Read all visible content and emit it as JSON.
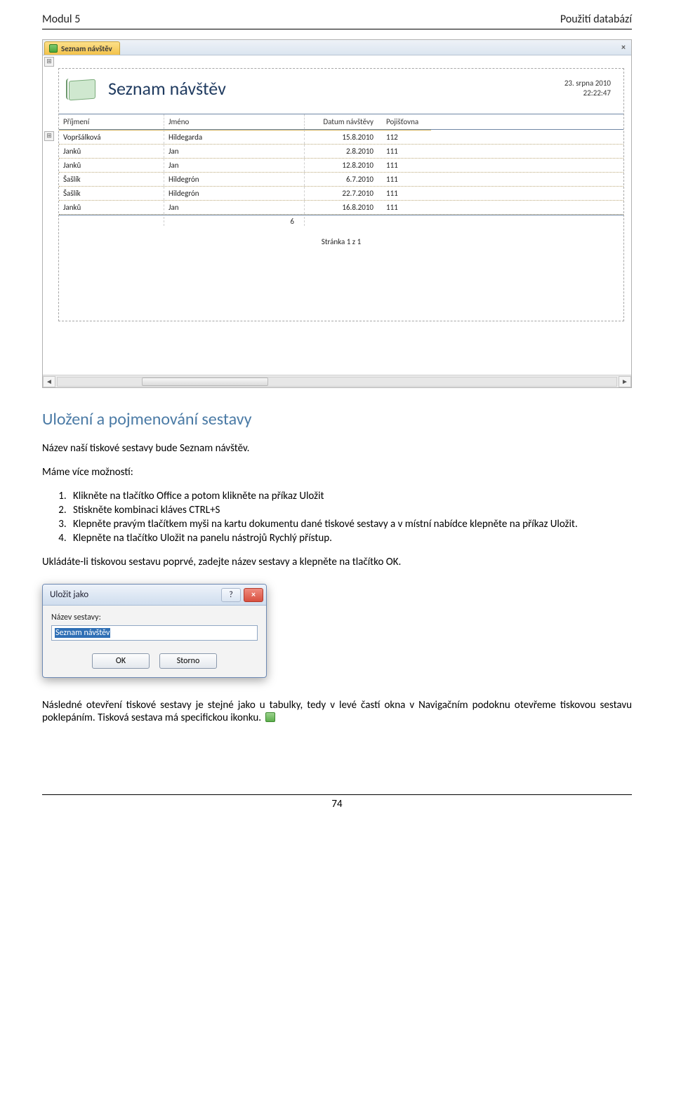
{
  "header": {
    "left": "Modul 5",
    "right": "Použití databází"
  },
  "report": {
    "tab_label": "Seznam návštěv",
    "close_glyph": "×",
    "title": "Seznam návštěv",
    "date": "23. srpna 2010",
    "time": "22:22:47",
    "columns": [
      "Příjmení",
      "Jméno",
      "Datum návštěvy",
      "Pojišťovna"
    ],
    "rows": [
      {
        "prijmeni": "Vopršálková",
        "jmeno": "Hildegarda",
        "datum": "15.8.2010",
        "poj": "112"
      },
      {
        "prijmeni": "Janků",
        "jmeno": "Jan",
        "datum": "2.8.2010",
        "poj": "111"
      },
      {
        "prijmeni": "Janků",
        "jmeno": "Jan",
        "datum": "12.8.2010",
        "poj": "111"
      },
      {
        "prijmeni": "Šašlík",
        "jmeno": "Hildegrón",
        "datum": "6.7.2010",
        "poj": "111"
      },
      {
        "prijmeni": "Šašlík",
        "jmeno": "Hildegrón",
        "datum": "22.7.2010",
        "poj": "111"
      },
      {
        "prijmeni": "Janků",
        "jmeno": "Jan",
        "datum": "16.8.2010",
        "poj": "111"
      }
    ],
    "count": "6",
    "pager": "Stránka 1 z 1",
    "corner_glyph": "⊞"
  },
  "section_heading": "Uložení a pojmenování sestavy",
  "p_intro": "Název naší tiskové sestavy bude Seznam návštěv.",
  "p_options": "Máme více možností:",
  "steps": [
    "Klikněte na tlačítko Office a potom klikněte na příkaz Uložit",
    "Stiskněte kombinaci kláves CTRL+S",
    "Klepněte pravým tlačítkem myši na kartu dokumentu dané tiskové sestavy a v místní nabídce klepněte na příkaz Uložit.",
    "Klepněte na tlačítko Uložit na panelu nástrojů Rychlý přístup."
  ],
  "p_first_save": "Ukládáte-li tiskovou sestavu poprvé, zadejte název sestavy a klepněte na tlačítko OK.",
  "dialog": {
    "title": "Uložit jako",
    "help_glyph": "?",
    "close_glyph": "×",
    "field_label": "Název sestavy:",
    "input_value": "Seznam návštěv",
    "ok": "OK",
    "cancel": "Storno"
  },
  "p_after": "Následné otevření tiskové sestavy je stejné jako u tabulky, tedy v levé častí okna v Navigačním podoknu otevřeme tiskovou sestavu poklepáním. Tisková sestava má specifickou ikonku.",
  "page_number": "74"
}
